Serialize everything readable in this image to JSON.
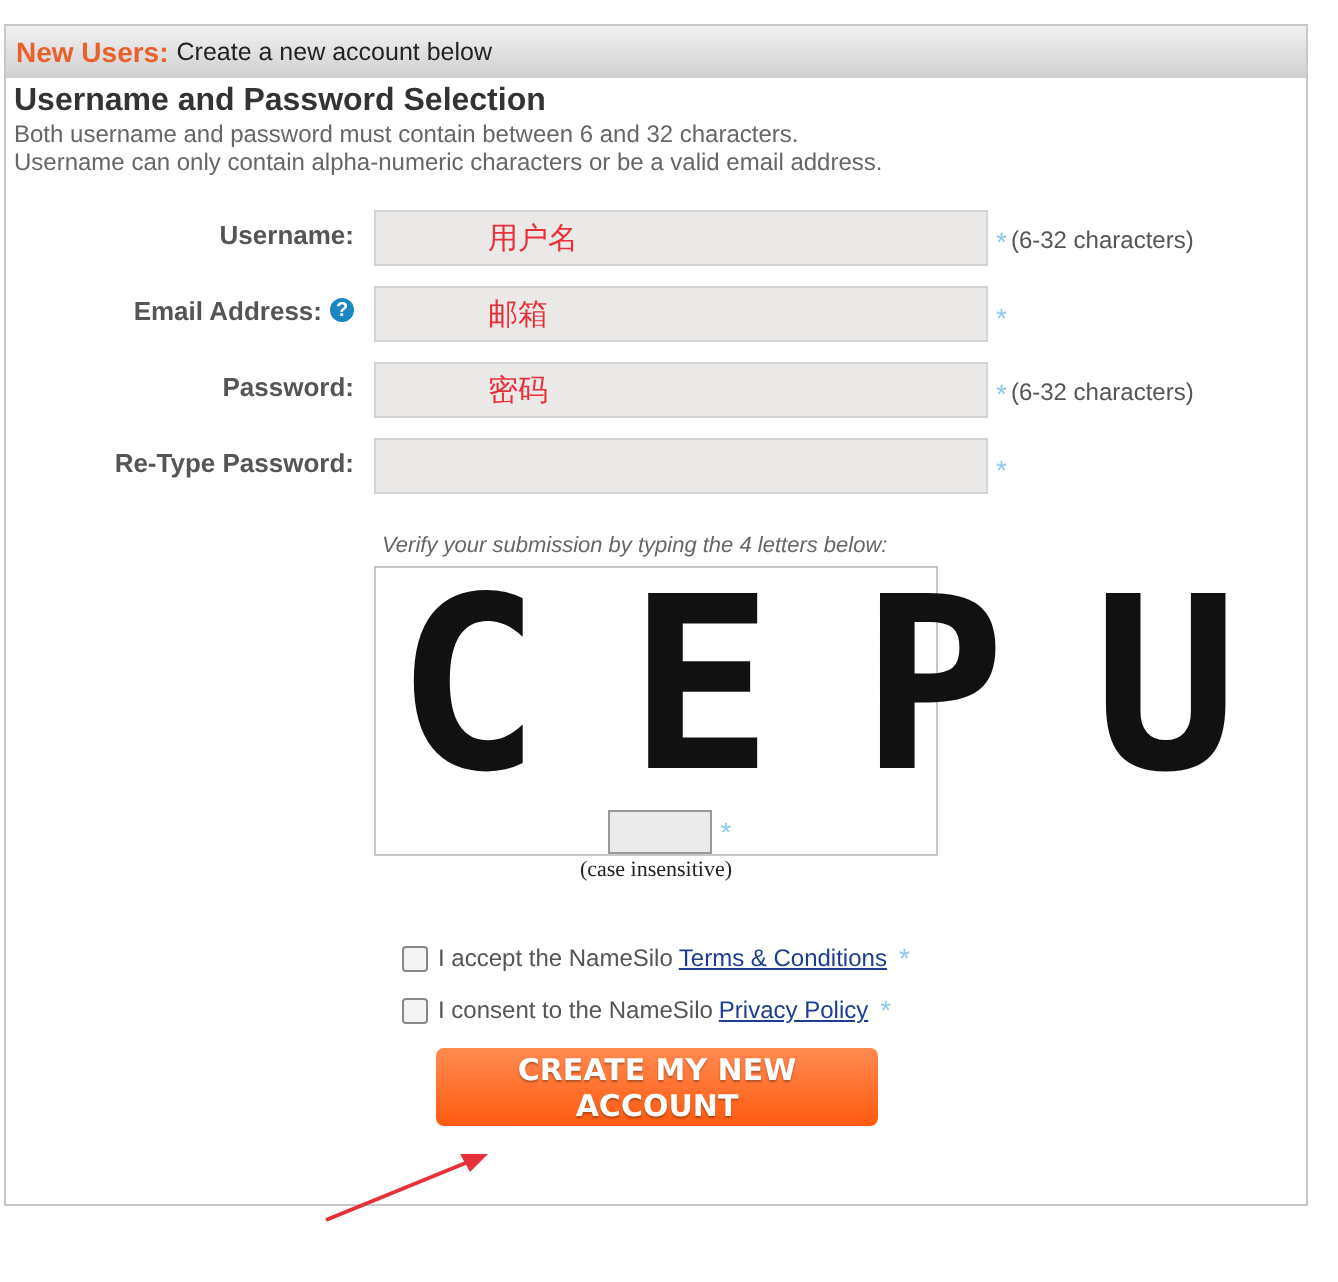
{
  "header": {
    "accent": "New Users:",
    "title": "Create a new account below"
  },
  "section": {
    "title": "Username and Password Selection",
    "notes": [
      "Both username and password must contain between 6 and 32 characters.",
      "Username can only contain alpha-numeric characters or be a valid email address."
    ]
  },
  "fields": [
    {
      "label": "Username:",
      "value": "用户名",
      "required_mark": "*",
      "hint": "(6-32 characters)"
    },
    {
      "label": "Email Address:",
      "help_icon": "?",
      "value": "邮箱",
      "required_mark": "*"
    },
    {
      "label": "Password:",
      "value": "密码",
      "required_mark": "*",
      "hint": "(6-32 characters)"
    },
    {
      "label": "Re-Type Password:",
      "required_mark": "*"
    }
  ],
  "captcha": {
    "prompt": "Verify your submission by typing the 4 letters below:",
    "letters": "CEPU",
    "required_mark": "*",
    "note": "(case insensitive)"
  },
  "agreements": [
    {
      "text": "I accept the NameSilo",
      "link": "Terms & Conditions",
      "checked": false,
      "required_mark": "*"
    },
    {
      "text": "I consent to the NameSilo",
      "link": "Privacy Policy",
      "checked": false,
      "required_mark": "*"
    }
  ],
  "submit_button": "CREATE MY NEW ACCOUNT"
}
